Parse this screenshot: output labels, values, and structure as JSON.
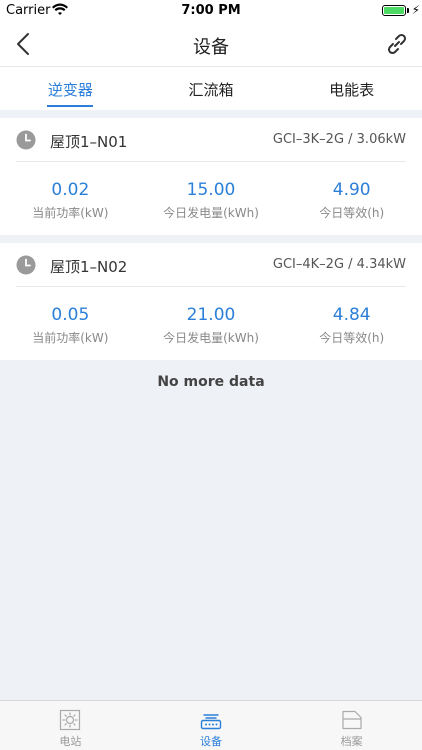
{
  "status_bar": {
    "carrier": "Carrier",
    "time": "7:00 PM"
  },
  "nav": {
    "title": "设备"
  },
  "tabs": [
    {
      "label": "逆变器",
      "active": true
    },
    {
      "label": "汇流箱",
      "active": false
    },
    {
      "label": "电能表",
      "active": false
    }
  ],
  "devices": [
    {
      "name": "屋顶1–N01",
      "model": "GCI–3K–2G / 3.06kW",
      "stats": [
        {
          "value": "0.02",
          "label": "当前功率(kW)"
        },
        {
          "value": "15.00",
          "label": "今日发电量(kWh)"
        },
        {
          "value": "4.90",
          "label": "今日等效(h)"
        }
      ]
    },
    {
      "name": "屋顶1–N02",
      "model": "GCI–4K–2G / 4.34kW",
      "stats": [
        {
          "value": "0.05",
          "label": "当前功率(kW)"
        },
        {
          "value": "21.00",
          "label": "今日发电量(kWh)"
        },
        {
          "value": "4.84",
          "label": "今日等效(h)"
        }
      ]
    }
  ],
  "list_footer": "No more data",
  "tabbar": [
    {
      "label": "电站",
      "icon": "sun-icon",
      "active": false
    },
    {
      "label": "设备",
      "icon": "device-icon",
      "active": true
    },
    {
      "label": "档案",
      "icon": "folder-icon",
      "active": false
    }
  ],
  "colors": {
    "accent": "#2b7fd8",
    "battery": "#4cd964"
  }
}
